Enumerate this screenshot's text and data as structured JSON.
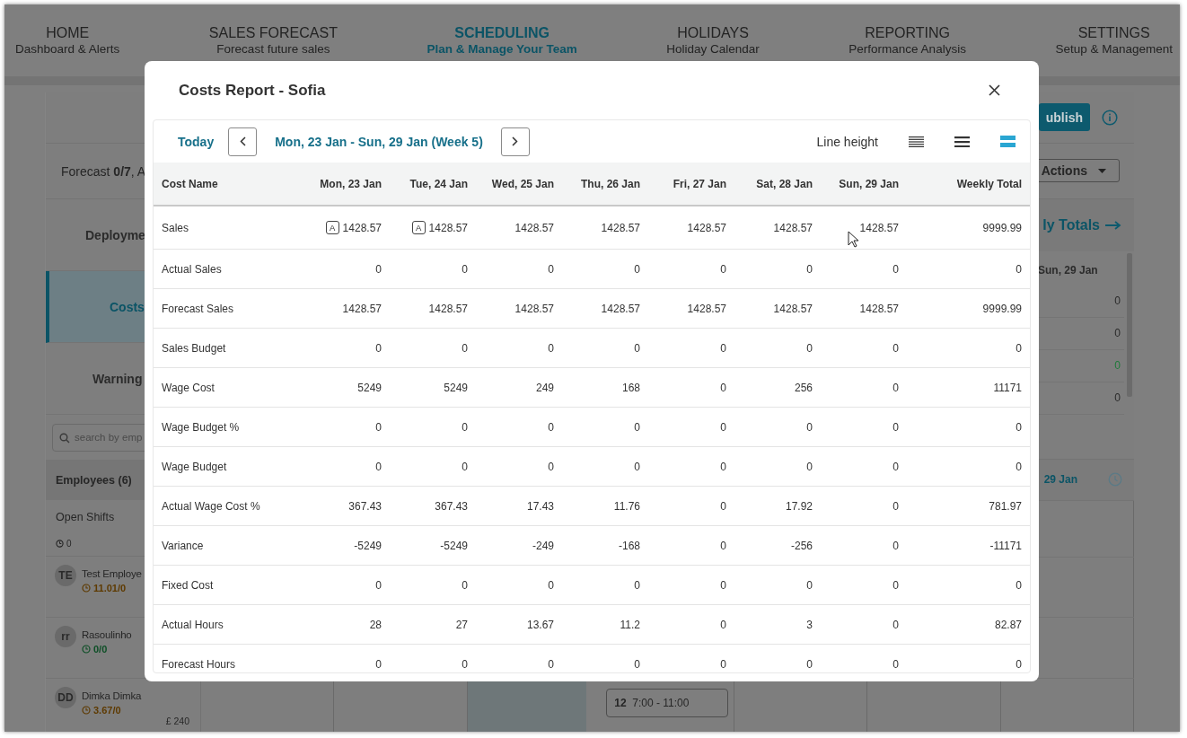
{
  "nav": [
    {
      "title": "HOME",
      "subtitle": "Dashboard & Alerts",
      "selected": false
    },
    {
      "title": "SALES FORECAST",
      "subtitle": "Forecast future sales",
      "selected": false
    },
    {
      "title": "SCHEDULING",
      "subtitle": "Plan & Manage Your Team",
      "selected": true
    },
    {
      "title": "HOLIDAYS",
      "subtitle": "Holiday Calendar",
      "selected": false
    },
    {
      "title": "REPORTING",
      "subtitle": "Performance Analysis",
      "selected": false
    },
    {
      "title": "SETTINGS",
      "subtitle": "Setup & Management",
      "selected": false
    }
  ],
  "toolbar": {
    "publish_button": "ublish",
    "actions_button": "Actions"
  },
  "sidebar": {
    "forecast": "Forecast **0/7**,  A",
    "tabs": [
      {
        "label": "Deployme",
        "selected": false
      },
      {
        "label": "Costs",
        "selected": true
      },
      {
        "label": "Warning",
        "selected": false
      }
    ],
    "search": {
      "placeholder": "search by emp"
    },
    "employees_header": "Employees (6)",
    "open_shifts": {
      "label": "Open Shifts",
      "hours": "0"
    },
    "employees": [
      {
        "initials": "TE",
        "name": "Test Employe",
        "hours": "11.01/0",
        "color": "#5e3a00"
      },
      {
        "initials": "rr",
        "name": "Rasoulinho",
        "hours": "0/0",
        "color": "#0d4f26"
      },
      {
        "initials": "DD",
        "name": "Dimka Dimka",
        "hours": "3.67/0",
        "color": "#5e3a00",
        "cost": "£ 240"
      }
    ]
  },
  "totals": {
    "title": "ly Totals",
    "date": "Sun, 29 Jan",
    "values": [
      {
        "text": "0",
        "color": "#2a2a2a"
      },
      {
        "text": "0",
        "color": "#2a2a2a"
      },
      {
        "text": "0",
        "color": "#1f7a3a"
      },
      {
        "text": "0",
        "color": "#2a2a2a"
      }
    ],
    "week_label": "29 Jan"
  },
  "schedule": {
    "last_row": [
      {
        "kind": "empty"
      },
      {
        "kind": "empty"
      },
      {
        "kind": "today"
      },
      {
        "kind": "shift",
        "number": "12",
        "time": "7:00 - 11:00"
      },
      {
        "kind": "empty"
      },
      {
        "kind": "empty"
      },
      {
        "kind": "empty"
      }
    ]
  },
  "modal": {
    "title": "Costs Report - Sofia",
    "today_button": "Today",
    "date_range": "Mon, 23 Jan - Sun, 29 Jan (Week 5)",
    "line_height_label": "Line height",
    "line_heights": [
      {
        "kind": "compact",
        "selected": false
      },
      {
        "kind": "normal",
        "selected": false
      },
      {
        "kind": "tall",
        "selected": true
      }
    ],
    "columns": [
      "Cost Name",
      "Mon, 23 Jan",
      "Tue, 24 Jan",
      "Wed, 25 Jan",
      "Thu, 26 Jan",
      "Fri, 27 Jan",
      "Sat, 28 Jan",
      "Sun, 29 Jan",
      "Weekly Total"
    ],
    "rows": [
      {
        "name": "Sales",
        "values": [
          {
            "badge": "A",
            "value": "1428.57"
          },
          {
            "badge": "A",
            "value": "1428.57"
          },
          "1428.57",
          "1428.57",
          "1428.57",
          "1428.57",
          "1428.57",
          "9999.99"
        ]
      },
      {
        "name": "Actual Sales",
        "values": [
          "0",
          "0",
          "0",
          "0",
          "0",
          "0",
          "0",
          "0"
        ]
      },
      {
        "name": "Forecast Sales",
        "values": [
          "1428.57",
          "1428.57",
          "1428.57",
          "1428.57",
          "1428.57",
          "1428.57",
          "1428.57",
          "9999.99"
        ]
      },
      {
        "name": "Sales Budget",
        "values": [
          "0",
          "0",
          "0",
          "0",
          "0",
          "0",
          "0",
          "0"
        ]
      },
      {
        "name": "Wage Cost",
        "values": [
          "5249",
          "5249",
          "249",
          "168",
          "0",
          "256",
          "0",
          "11171"
        ]
      },
      {
        "name": "Wage Budget %",
        "values": [
          "0",
          "0",
          "0",
          "0",
          "0",
          "0",
          "0",
          "0"
        ]
      },
      {
        "name": "Wage Budget",
        "values": [
          "0",
          "0",
          "0",
          "0",
          "0",
          "0",
          "0",
          "0"
        ]
      },
      {
        "name": "Actual Wage Cost %",
        "values": [
          "367.43",
          "367.43",
          "17.43",
          "11.76",
          "0",
          "17.92",
          "0",
          "781.97"
        ]
      },
      {
        "name": "Variance",
        "values": [
          "-5249",
          "-5249",
          "-249",
          "-168",
          "0",
          "-256",
          "0",
          "-11171"
        ]
      },
      {
        "name": "Fixed Cost",
        "values": [
          "0",
          "0",
          "0",
          "0",
          "0",
          "0",
          "0",
          "0"
        ]
      },
      {
        "name": "Actual Hours",
        "values": [
          "28",
          "27",
          "13.67",
          "11.2",
          "0",
          "3",
          "0",
          "82.87"
        ]
      },
      {
        "name": "Forecast Hours",
        "values": [
          "0",
          "0",
          "0",
          "0",
          "0",
          "0",
          "0",
          "0"
        ]
      }
    ]
  }
}
